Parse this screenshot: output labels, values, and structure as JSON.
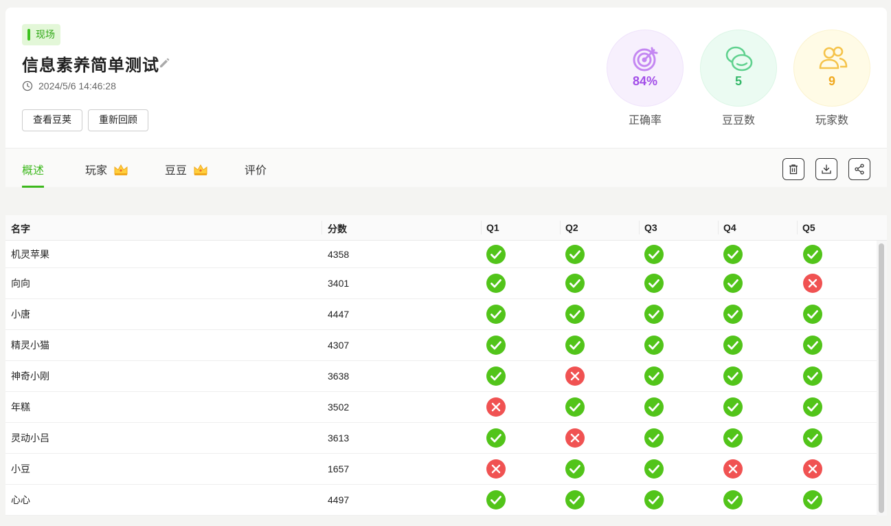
{
  "header": {
    "tag": "现场",
    "title": "信息素养简单测试",
    "datetime": "2024/5/6 14:46:28",
    "btn_view": "查看豆荚",
    "btn_replay": "重新回顾"
  },
  "stats": {
    "accuracy": {
      "value": "84%",
      "label": "正确率",
      "icon": "target-icon",
      "color": "#a24de8"
    },
    "beans": {
      "value": "5",
      "label": "豆豆数",
      "icon": "beans-icon",
      "color": "#35b86a"
    },
    "players": {
      "value": "9",
      "label": "玩家数",
      "icon": "users-icon",
      "color": "#f0a81e"
    }
  },
  "tabs": [
    {
      "label": "概述",
      "active": true
    },
    {
      "label": "玩家",
      "crown": true
    },
    {
      "label": "豆豆",
      "crown": true
    },
    {
      "label": "评价"
    }
  ],
  "toolbar": [
    "trash-icon",
    "download-icon",
    "share-icon"
  ],
  "table": {
    "columns": [
      "名字",
      "分数",
      "Q1",
      "Q2",
      "Q3",
      "Q4",
      "Q5"
    ],
    "rows": [
      {
        "name": "机灵苹果",
        "score": "4358",
        "answers": [
          true,
          true,
          true,
          true,
          true
        ]
      },
      {
        "name": "向向",
        "score": "3401",
        "answers": [
          true,
          true,
          true,
          true,
          false
        ]
      },
      {
        "name": "小唐",
        "score": "4447",
        "answers": [
          true,
          true,
          true,
          true,
          true
        ]
      },
      {
        "name": "精灵小猫",
        "score": "4307",
        "answers": [
          true,
          true,
          true,
          true,
          true
        ]
      },
      {
        "name": "神奇小刚",
        "score": "3638",
        "answers": [
          true,
          false,
          true,
          true,
          true
        ]
      },
      {
        "name": "年糕",
        "score": "3502",
        "answers": [
          false,
          true,
          true,
          true,
          true
        ]
      },
      {
        "name": "灵动小吕",
        "score": "3613",
        "answers": [
          true,
          false,
          true,
          true,
          true
        ]
      },
      {
        "name": "小豆",
        "score": "1657",
        "answers": [
          false,
          true,
          true,
          false,
          false
        ]
      },
      {
        "name": "心心",
        "score": "4497",
        "answers": [
          true,
          true,
          true,
          true,
          true
        ]
      }
    ]
  },
  "colors": {
    "correct": "#52c41a",
    "wrong": "#f05252",
    "accent": "#3cb81c"
  }
}
